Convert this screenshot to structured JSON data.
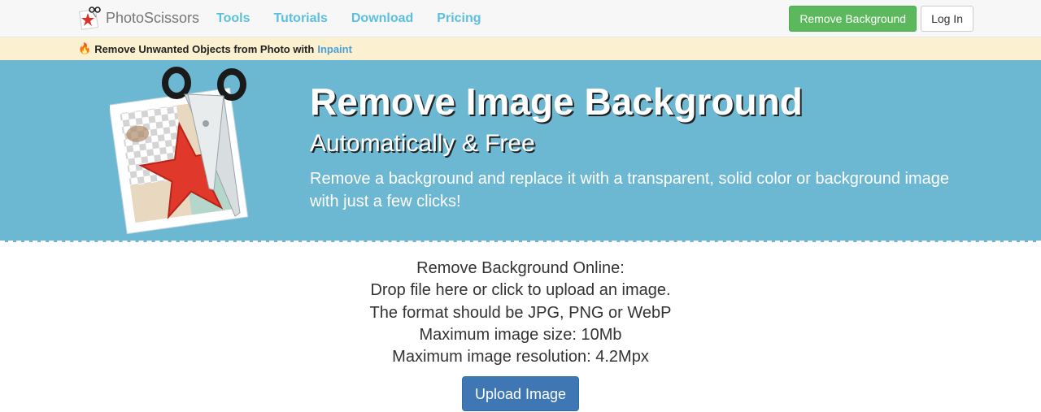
{
  "nav": {
    "brand": "PhotoScissors",
    "links": [
      "Tools",
      "Tutorials",
      "Download",
      "Pricing"
    ],
    "remove_bg_button": "Remove Background",
    "login_button": "Log In"
  },
  "promo": {
    "text": "Remove Unwanted Objects from Photo with",
    "link": "Inpaint"
  },
  "hero": {
    "title": "Remove Image Background",
    "subtitle": "Automatically & Free",
    "description": "Remove a background and replace it with a transparent, solid color or background image with just a few clicks!"
  },
  "upload": {
    "lines": [
      "Remove Background Online:",
      "Drop file here or click to upload an image.",
      "The format should be JPG, PNG or WebP",
      "Maximum image size: 10Mb",
      "Maximum image resolution: 4.2Mpx"
    ],
    "button": "Upload Image"
  },
  "colors": {
    "hero_bg": "#6cb7d2",
    "nav_link": "#5bc0de",
    "green_button": "#5cb85c",
    "upload_button": "#3f77b5",
    "promo_bg": "#fbf0cf"
  },
  "icons": [
    "scissors-star-logo-icon",
    "fire-icon"
  ]
}
